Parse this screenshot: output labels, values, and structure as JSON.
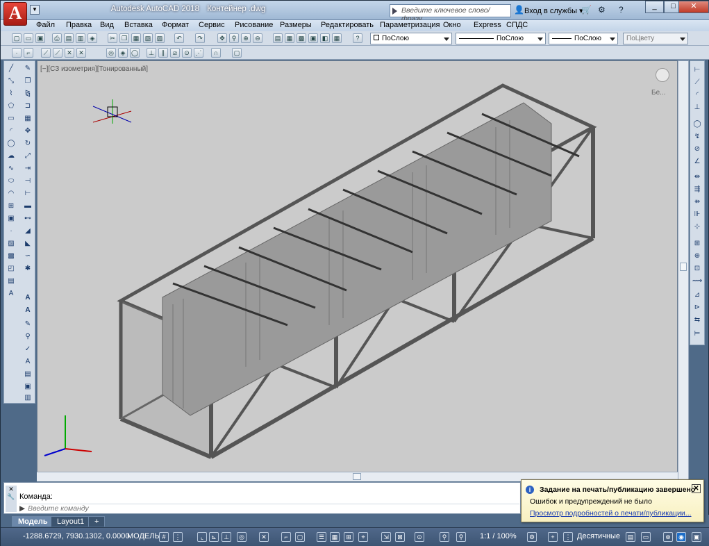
{
  "titlebar": {
    "app": "Autodesk AutoCAD 2018",
    "file": "Контейнер .dwg",
    "search_placeholder": "Введите ключевое слово/фразу",
    "login": "Вход в службы",
    "logo": "A"
  },
  "menu": [
    "Файл",
    "Правка",
    "Вид",
    "Вставка",
    "Формат",
    "Сервис",
    "Рисование",
    "Размеры",
    "Редактировать",
    "Параметризация",
    "Окно",
    "Express",
    "СПДС"
  ],
  "toolbar": {
    "layer_combo": "ПоСлою",
    "linetype_combo": "ПоСлою",
    "lineweight_combo": "ПоСлою",
    "plotstyle_combo": "ПоЦвету"
  },
  "viewport": {
    "label": "[−][СЗ изометрия][Тонированный]",
    "viewcube_label": "Бе..."
  },
  "command": {
    "label": "Команда:",
    "placeholder": "Введите команду"
  },
  "tabs": [
    "Модель",
    "Layout1",
    "+"
  ],
  "status": {
    "coords": "-1288.6729, 7930.1302, 0.0000",
    "model": "МОДЕЛЬ",
    "scale": "1:1 / 100%",
    "units": "Десятичные"
  },
  "notification": {
    "title": "Задание на печать/публикацию завершено",
    "line": "Ошибок и предупреждений не было",
    "link": "Просмотр подробностей о печати/публикации..."
  },
  "colors": {
    "accent": "#c62a1e",
    "viewport_bg": "#cbcbcb",
    "status_bg": "#3d5573"
  }
}
